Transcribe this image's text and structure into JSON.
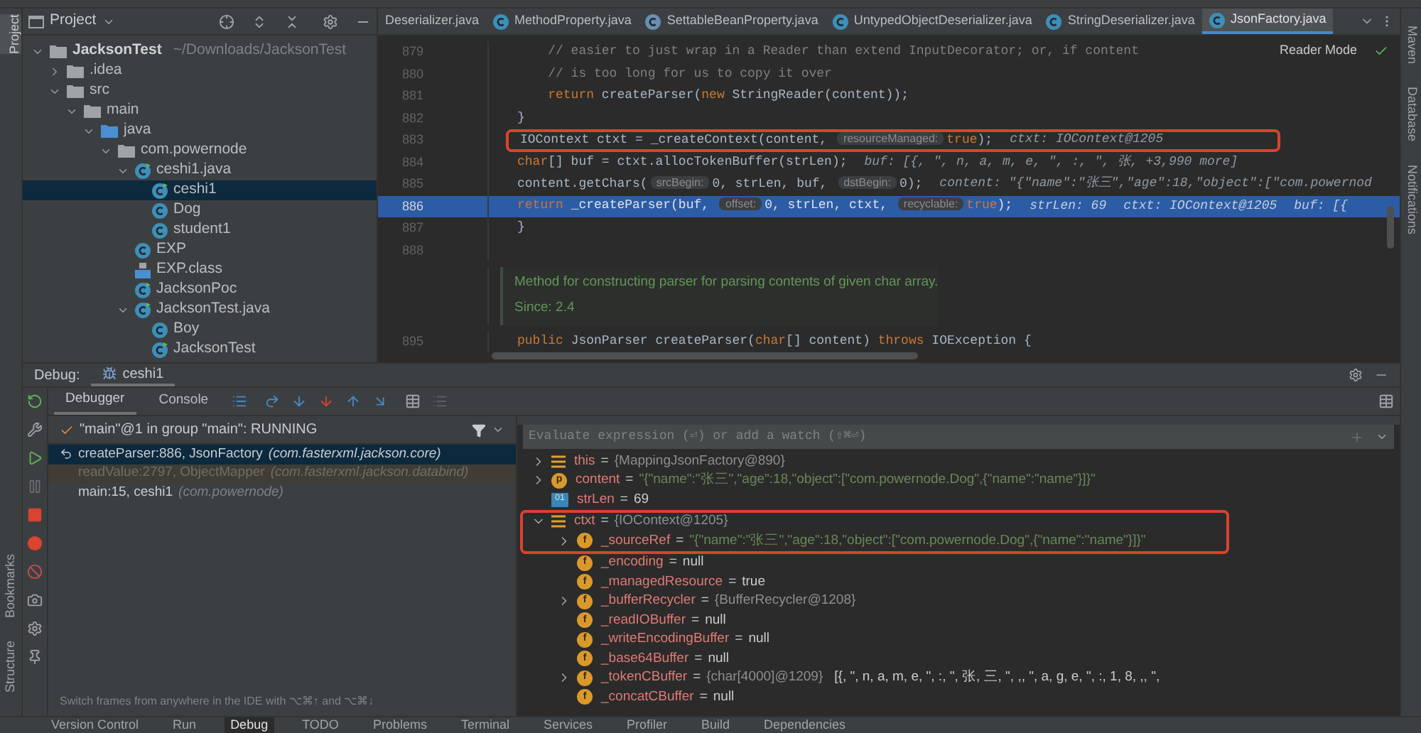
{
  "left_stripe": {
    "top": [
      {
        "label": "Project",
        "selected": true
      }
    ],
    "bottom": [
      {
        "label": "Bookmarks",
        "selected": false
      },
      {
        "label": "Structure",
        "selected": false
      }
    ]
  },
  "project_panel": {
    "title": "Project",
    "tree": [
      {
        "label": "JacksonTest",
        "suffix": "~/Downloads/JacksonTest",
        "kind": "project",
        "expanded": true,
        "selected": false,
        "children": [
          {
            "label": ".idea",
            "kind": "folder",
            "expanded": false,
            "selected": false
          },
          {
            "label": "src",
            "kind": "folder",
            "expanded": true,
            "selected": false,
            "children": [
              {
                "label": "main",
                "kind": "folder",
                "expanded": true,
                "selected": false,
                "children": [
                  {
                    "label": "java",
                    "kind": "source",
                    "expanded": true,
                    "selected": false,
                    "children": [
                      {
                        "label": "com.powernode",
                        "kind": "package",
                        "expanded": true,
                        "selected": false,
                        "children": [
                          {
                            "label": "ceshi1.java",
                            "kind": "runnable",
                            "expanded": true,
                            "selected": false,
                            "children": [
                              {
                                "label": "ceshi1",
                                "kind": "runnable",
                                "selected": true
                              },
                              {
                                "label": "Dog",
                                "kind": "class",
                                "selected": false
                              },
                              {
                                "label": "student1",
                                "kind": "class",
                                "selected": false
                              }
                            ]
                          },
                          {
                            "label": "EXP",
                            "kind": "class",
                            "selected": false
                          },
                          {
                            "label": "EXP.class",
                            "kind": "binary",
                            "selected": false
                          },
                          {
                            "label": "JacksonPoc",
                            "kind": "runnable",
                            "selected": false
                          },
                          {
                            "label": "JacksonTest.java",
                            "kind": "runnable",
                            "expanded": true,
                            "selected": false,
                            "children": [
                              {
                                "label": "Boy",
                                "kind": "class",
                                "selected": false
                              },
                              {
                                "label": "JacksonTest",
                                "kind": "runnable",
                                "selected": false
                              }
                            ]
                          }
                        ]
                      }
                    ]
                  }
                ]
              }
            ]
          }
        ]
      }
    ]
  },
  "editor_tabs": [
    {
      "label": "Deserializer.java",
      "selected": false
    },
    {
      "label": "MethodProperty.java",
      "kind": "class",
      "selected": false
    },
    {
      "label": "SettableBeanProperty.java",
      "kind": "abstract",
      "selected": false
    },
    {
      "label": "UntypedObjectDeserializer.java",
      "kind": "class",
      "selected": false
    },
    {
      "label": "StringDeserializer.java",
      "kind": "class",
      "selected": false
    },
    {
      "label": "JsonFactory.java",
      "kind": "class",
      "selected": true
    }
  ],
  "reader_mode": "Reader Mode",
  "editor_lines": [
    {
      "kind": "code",
      "number": "879",
      "current": false,
      "outlined": false,
      "tokens": [
        {
          "kind": "comment",
          "text": "    // easier to just wrap in a Reader than extend InputDecorator; or, if content"
        }
      ]
    },
    {
      "kind": "code",
      "number": "880",
      "current": false,
      "outlined": false,
      "tokens": [
        {
          "kind": "comment",
          "text": "    // is too long for us to copy it over"
        }
      ]
    },
    {
      "kind": "code",
      "number": "881",
      "current": false,
      "outlined": false,
      "tokens": [
        {
          "kind": "kw",
          "text": "    return "
        },
        {
          "kind": "code",
          "text": "createParser("
        },
        {
          "kind": "kw",
          "text": "new "
        },
        {
          "kind": "code",
          "text": "StringReader(content));"
        }
      ]
    },
    {
      "kind": "code",
      "number": "882",
      "current": false,
      "outlined": false,
      "tokens": [
        {
          "kind": "code",
          "text": "}"
        }
      ]
    },
    {
      "kind": "code",
      "number": "883",
      "current": false,
      "outlined": true,
      "tokens": [
        {
          "kind": "code",
          "text": "IOContext ctxt = _createContext(content, "
        },
        {
          "kind": "hint",
          "text": "resourceManaged:"
        },
        {
          "kind": "kw",
          "text": "true"
        },
        {
          "kind": "code",
          "text": ");"
        },
        {
          "kind": "value",
          "text": "ctxt: IOContext@1205"
        }
      ]
    },
    {
      "kind": "code",
      "number": "884",
      "current": false,
      "outlined": false,
      "tokens": [
        {
          "kind": "kw",
          "text": "char"
        },
        {
          "kind": "code",
          "text": "[] buf = ctxt.allocTokenBuffer(strLen);"
        },
        {
          "kind": "value",
          "text": "buf: [{, \", n, a, m, e, \", :, \", 张, +3,990 more]"
        }
      ]
    },
    {
      "kind": "code",
      "number": "885",
      "current": false,
      "outlined": false,
      "tokens": [
        {
          "kind": "code",
          "text": "content.getChars("
        },
        {
          "kind": "hint",
          "text": "srcBegin:"
        },
        {
          "kind": "code",
          "text": "0, strLen, buf, "
        },
        {
          "kind": "hint",
          "text": "dstBegin:"
        },
        {
          "kind": "code",
          "text": "0);"
        },
        {
          "kind": "value",
          "text": "content: \"{\"name\":\"张三\",\"age\":18,\"object\":[\"com.powernod"
        }
      ]
    },
    {
      "kind": "code",
      "number": "886",
      "current": true,
      "outlined": false,
      "tokens": [
        {
          "kind": "kw",
          "text": "return "
        },
        {
          "kind": "code",
          "text": "_createParser(buf, "
        },
        {
          "kind": "hint",
          "text": "offset:"
        },
        {
          "kind": "code",
          "text": "0, strLen, ctxt, "
        },
        {
          "kind": "hint",
          "text": "recyclable:"
        },
        {
          "kind": "kw",
          "text": "true"
        },
        {
          "kind": "code",
          "text": ");"
        },
        {
          "kind": "value",
          "text": "strLen: 69"
        },
        {
          "kind": "value",
          "text": "ctxt: IOContext@1205"
        },
        {
          "kind": "value",
          "text": "buf: [{"
        }
      ]
    },
    {
      "kind": "code",
      "number": "887",
      "current": false,
      "outlined": false,
      "tokens": [
        {
          "kind": "code",
          "text": "}"
        }
      ]
    },
    {
      "kind": "code",
      "number": "888",
      "current": false,
      "outlined": false
    },
    {
      "kind": "doc",
      "text": "Method for constructing parser for parsing contents of given char array.",
      "since": "Since: 2.4"
    },
    {
      "kind": "code",
      "number": "895",
      "current": false,
      "outlined": false,
      "tokens": [
        {
          "kind": "kw",
          "text": "public "
        },
        {
          "kind": "code",
          "text": "JsonParser createParser("
        },
        {
          "kind": "kw",
          "text": "char"
        },
        {
          "kind": "code",
          "text": "[] content) "
        },
        {
          "kind": "kw",
          "text": "throws "
        },
        {
          "kind": "code",
          "text": "IOException {"
        }
      ]
    }
  ],
  "right_stripe": [
    "Maven",
    "Database",
    "Notifications"
  ],
  "debug": {
    "title": "Debug:",
    "session": "ceshi1",
    "tabs": [
      {
        "label": "Debugger",
        "selected": true
      },
      {
        "label": "Console",
        "selected": false
      }
    ],
    "thread": "\"main\"@1 in group \"main\": RUNNING",
    "frames": [
      {
        "method": "createParser:886, JsonFactory",
        "package": "(com.fasterxml.jackson.core)",
        "kind": "current",
        "selected": true
      },
      {
        "method": "readValue:2797, ObjectMapper",
        "package": "(com.fasterxml.jackson.databind)",
        "kind": "library",
        "selected": false
      },
      {
        "method": "main:15, ceshi1",
        "package": "(com.powernode)",
        "kind": "user",
        "selected": false
      }
    ],
    "frames_hint": "Switch frames from anywhere in the IDE with ⌥⌘↑ and ⌥⌘↓",
    "evaluate_placeholder": "Evaluate expression (⏎) or add a watch (⇧⌘⏎)",
    "variables": [
      {
        "name": "this",
        "separator": "=",
        "value": {
          "kind": "ref",
          "text": "{MappingJsonFactory@890}"
        },
        "kind": "object",
        "expanded": false,
        "outlined": false
      },
      {
        "name": "content",
        "separator": "=",
        "value": {
          "kind": "string",
          "text": "\"{\"name\":\"张三\",\"age\":18,\"object\":[\"com.powernode.Dog\",{\"name\":\"name\"}]}\""
        },
        "kind": "param",
        "badge": "p",
        "expanded": false,
        "outlined": false
      },
      {
        "name": "strLen",
        "separator": "=",
        "value": {
          "kind": "plain",
          "text": "69"
        },
        "kind": "local",
        "badge": "01",
        "outlined": false
      },
      {
        "name": "ctxt",
        "separator": "=",
        "value": {
          "kind": "ref",
          "text": "{IOContext@1205}"
        },
        "kind": "object",
        "expanded": true,
        "outlined": true,
        "children": [
          {
            "name": "_sourceRef",
            "separator": "=",
            "value": {
              "kind": "string",
              "text": "\"{\"name\":\"张三\",\"age\":18,\"object\":[\"com.powernode.Dog\",{\"name\":\"name\"}]}\""
            },
            "kind": "field",
            "badge": "f",
            "expanded": false,
            "outlined": true
          },
          {
            "name": "_encoding",
            "separator": "=",
            "value": {
              "kind": "plain",
              "text": "null"
            },
            "kind": "field",
            "badge": "f",
            "outlined": false
          },
          {
            "name": "_managedResource",
            "separator": "=",
            "value": {
              "kind": "plain",
              "text": "true"
            },
            "kind": "field",
            "badge": "f",
            "outlined": false
          },
          {
            "name": "_bufferRecycler",
            "separator": "=",
            "value": {
              "kind": "ref",
              "text": "{BufferRecycler@1208}"
            },
            "kind": "field",
            "badge": "f",
            "expanded": false,
            "outlined": false
          },
          {
            "name": "_readIOBuffer",
            "separator": "=",
            "value": {
              "kind": "plain",
              "text": "null"
            },
            "kind": "field",
            "badge": "f",
            "outlined": false
          },
          {
            "name": "_writeEncodingBuffer",
            "separator": "=",
            "value": {
              "kind": "plain",
              "text": "null"
            },
            "kind": "field",
            "badge": "f",
            "outlined": false
          },
          {
            "name": "_base64Buffer",
            "separator": "=",
            "value": {
              "kind": "plain",
              "text": "null"
            },
            "kind": "field",
            "badge": "f",
            "outlined": false
          },
          {
            "name": "_tokenCBuffer",
            "separator": "=",
            "value": {
              "kind": "ref",
              "text": "{char[4000]@1209}"
            },
            "extra": "[{, \", n, a, m, e, \", :, \", 张, 三, \", ,, \", a, g, e, \", :, 1, 8, ,, \",",
            "kind": "field",
            "badge": "f",
            "expanded": false,
            "outlined": false
          },
          {
            "name": "_concatCBuffer",
            "separator": "=",
            "value": {
              "kind": "plain",
              "text": "null"
            },
            "kind": "field",
            "badge": "f",
            "outlined": false
          }
        ]
      }
    ]
  },
  "bottom_tools": [
    {
      "label": "Version Control",
      "selected": false
    },
    {
      "label": "Run",
      "selected": false
    },
    {
      "label": "Debug",
      "selected": true
    },
    {
      "label": "TODO",
      "selected": false
    },
    {
      "label": "Problems",
      "selected": false
    },
    {
      "label": "Terminal",
      "selected": false
    },
    {
      "label": "Services",
      "selected": false
    },
    {
      "label": "Profiler",
      "selected": false
    },
    {
      "label": "Build",
      "selected": false
    },
    {
      "label": "Dependencies",
      "selected": false
    }
  ]
}
